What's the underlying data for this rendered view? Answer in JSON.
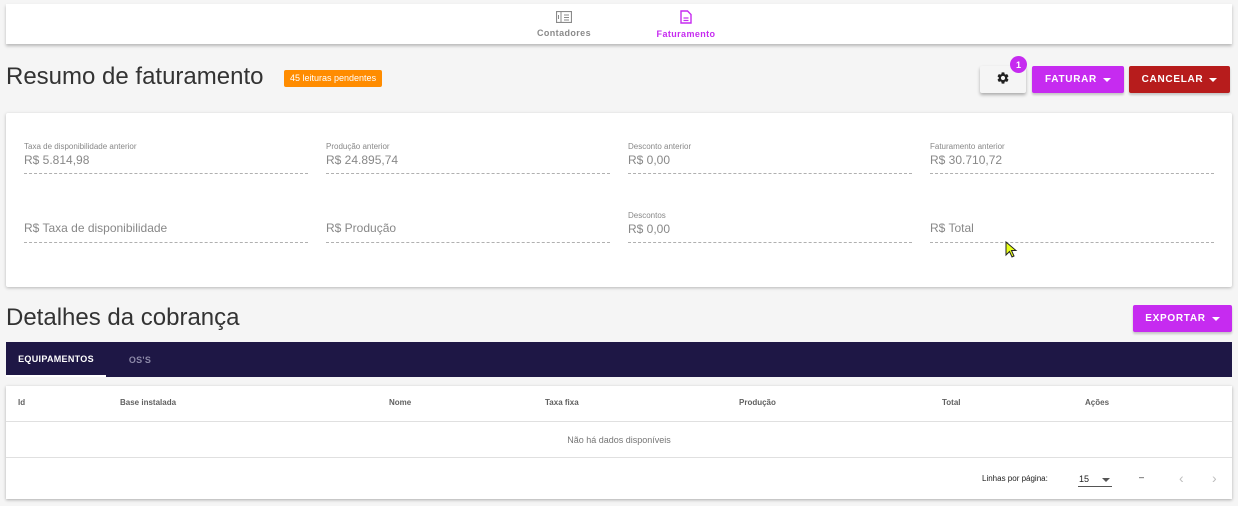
{
  "nav": {
    "items": [
      {
        "label": "Contadores",
        "icon": "counter-icon"
      },
      {
        "label": "Faturamento",
        "icon": "document-icon"
      }
    ],
    "active": "Faturamento"
  },
  "resumo": {
    "title": "Resumo de faturamento",
    "pending_badge": "45 leituras pendentes",
    "settings_badge": "1",
    "faturar_label": "FATURAR",
    "cancelar_label": "CANCELAR",
    "previous": [
      {
        "label": "Taxa de disponibilidade anterior",
        "value": "R$ 5.814,98"
      },
      {
        "label": "Produção anterior",
        "value": "R$ 24.895,74"
      },
      {
        "label": "Desconto anterior",
        "value": "R$ 0,00"
      },
      {
        "label": "Faturamento anterior",
        "value": "R$ 30.710,72"
      }
    ],
    "current": {
      "taxa_placeholder": "R$ Taxa de disponibilidade",
      "producao_placeholder": "R$ Produção",
      "descontos_label": "Descontos",
      "descontos_value": "R$ 0,00",
      "total_placeholder": "R$ Total"
    }
  },
  "detalhes": {
    "title": "Detalhes da cobrança",
    "exportar_label": "EXPORTAR",
    "tabs": [
      "EQUIPAMENTOS",
      "OS'S"
    ],
    "columns": [
      "Id",
      "Base instalada",
      "Nome",
      "Taxa fixa",
      "Produção",
      "Total",
      "Ações"
    ],
    "empty_text": "Não há dados disponíveis",
    "rows_per_page_label": "Linhas por página:",
    "rows_per_page_value": "15",
    "range_text": "–"
  },
  "colors": {
    "accent": "#c62bf0",
    "danger": "#b71c1c",
    "warning": "#ff8c00",
    "tabs_bg": "#1e1745"
  }
}
